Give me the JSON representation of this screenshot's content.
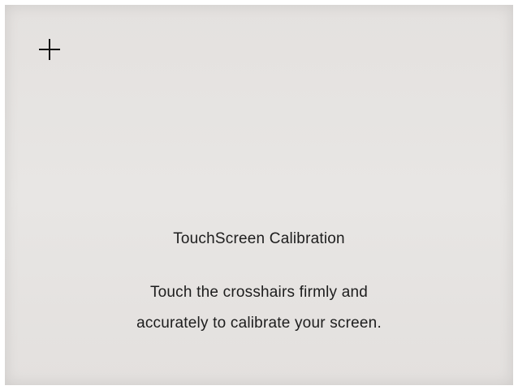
{
  "calibration": {
    "target_icon": "crosshair-icon",
    "title": "TouchScreen Calibration",
    "instruction_line_1": "Touch the crosshairs firmly and",
    "instruction_line_2": "accurately to calibrate your screen."
  },
  "colors": {
    "screen_background": "#e6e3e1",
    "text": "#1d1d1d",
    "crosshair": "#111111"
  }
}
